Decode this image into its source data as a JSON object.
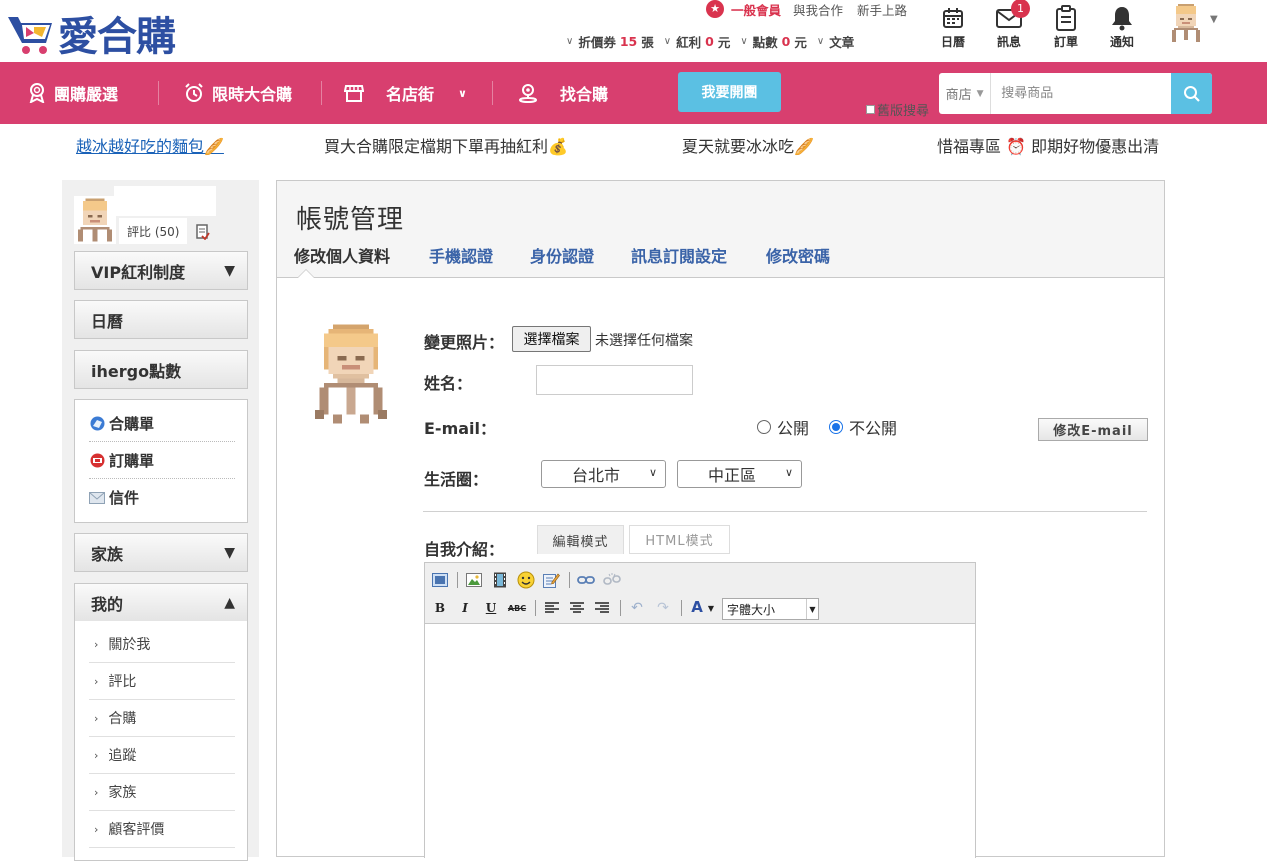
{
  "brand": {
    "logo_text": "愛合購",
    "accent": "#d83f6f",
    "blue": "#2d4fa2",
    "cyan": "#5bc0e3"
  },
  "header": {
    "member_label": "一般會員",
    "cooperate_link": "與我合作",
    "newbie_link": "新手上路",
    "stats": [
      {
        "label": "折價券",
        "value": "15",
        "unit": "張"
      },
      {
        "label": "紅利",
        "value": "0",
        "unit": "元"
      },
      {
        "label": "點數",
        "value": "0",
        "unit": "元"
      },
      {
        "label": "文章",
        "value": "",
        "unit": ""
      }
    ],
    "icons": [
      {
        "label": "日曆",
        "icon": "calendar-icon"
      },
      {
        "label": "訊息",
        "icon": "mail-icon",
        "badge": "1"
      },
      {
        "label": "訂單",
        "icon": "clipboard-icon"
      },
      {
        "label": "通知",
        "icon": "bell-icon"
      }
    ]
  },
  "navbar": {
    "items": [
      {
        "label": "團購嚴選",
        "icon": "award-icon"
      },
      {
        "label": "限時大合購",
        "icon": "alarm-clock-icon"
      },
      {
        "label": "名店街",
        "icon": "storefront-icon"
      },
      {
        "label": "找合購",
        "icon": "person-pin-icon"
      }
    ],
    "open_group_button": "我要開團",
    "old_search_label": "舊版搜尋",
    "search": {
      "category": "商店",
      "placeholder": "搜尋商品"
    }
  },
  "promos": [
    {
      "text": "越冰越好吃的麵包🥖",
      "link": true
    },
    {
      "text": "買大合購限定檔期下單再抽紅利💰",
      "link": false
    },
    {
      "text": "夏天就要冰冰吃🥖",
      "link": false
    },
    {
      "text": "惜福專區 ⏰ 即期好物優惠出清",
      "link": false
    }
  ],
  "sidebar": {
    "rating_text": "評比 (50)",
    "vip_label": "VIP紅利制度",
    "calendar_label": "日曆",
    "points_label": "ihergo點數",
    "shop_items": [
      {
        "label": "合購單",
        "icon": "globe-icon"
      },
      {
        "label": "訂購單",
        "icon": "red-badge-icon"
      },
      {
        "label": "信件",
        "icon": "envelope-icon"
      }
    ],
    "family_label": "家族",
    "mine_label": "我的",
    "mine_items": [
      "關於我",
      "評比",
      "合購",
      "追蹤",
      "家族",
      "顧客評價"
    ]
  },
  "main": {
    "title": "帳號管理",
    "tabs": [
      "修改個人資料",
      "手機認證",
      "身份認證",
      "訊息訂閱設定",
      "修改密碼"
    ],
    "active_tab": 0,
    "form": {
      "photo_label": "變更照片：",
      "file_button": "選擇檔案",
      "file_status": "未選擇任何檔案",
      "name_label": "姓名：",
      "name_value": "",
      "email_label": "E-mail：",
      "public_label": "公開",
      "private_label": "不公開",
      "email_visibility": "不公開",
      "edit_email_button": "修改E-mail",
      "area_label": "生活圈：",
      "city": "台北市",
      "district": "中正區",
      "intro_label": "自我介紹：",
      "edit_mode_tab": "編輯模式",
      "html_mode_tab": "HTML模式",
      "font_size_select": "字體大小",
      "editor_content": ""
    }
  }
}
